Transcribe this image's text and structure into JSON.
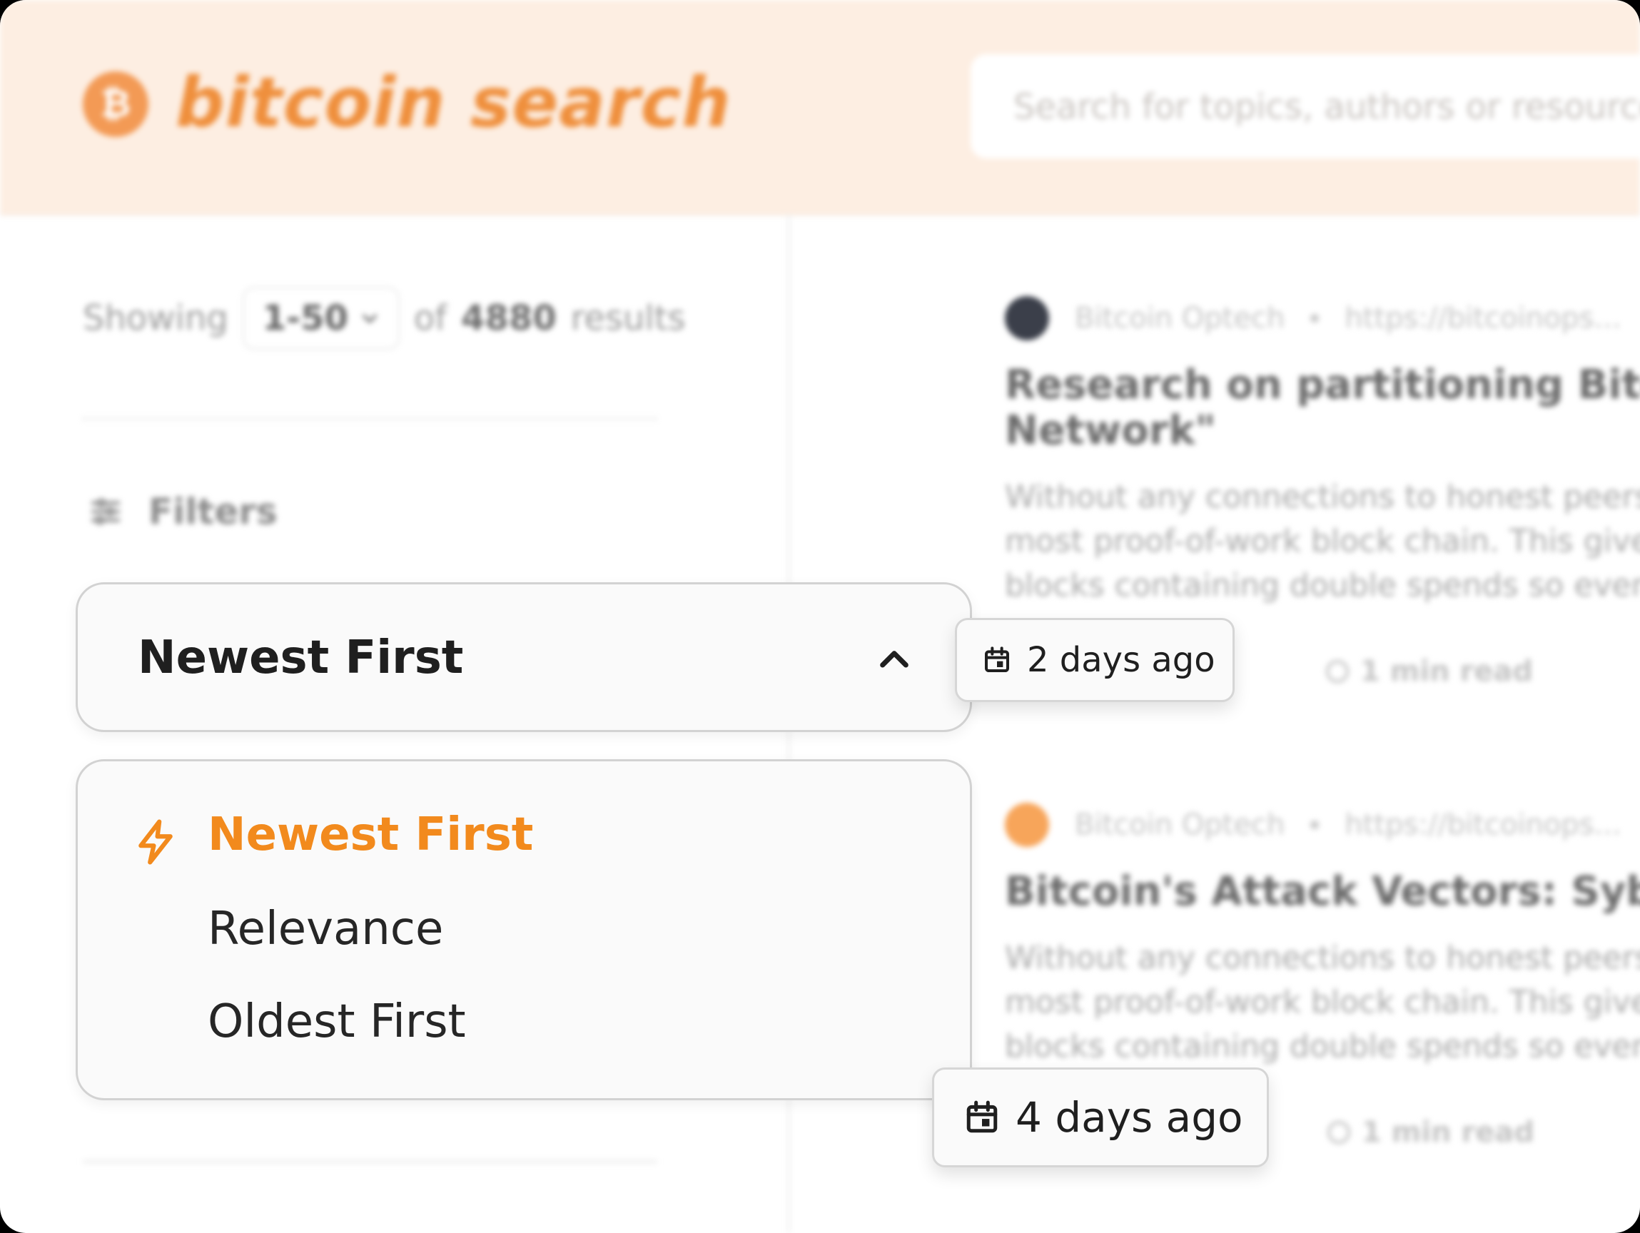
{
  "colors": {
    "accent": "#f28a1d",
    "header_bg": "#fdeee2",
    "logo": "#ef8f3c"
  },
  "header": {
    "brand": "bitcoin search",
    "logo_glyph": "₿",
    "search_placeholder": "Search for topics, authors or resources..."
  },
  "sidebar": {
    "showing_label": "Showing",
    "range": "1-50",
    "of_label": "of",
    "total": "4880",
    "results_label": "results",
    "filters_label": "Filters"
  },
  "sort": {
    "selected": "Newest First",
    "options": [
      {
        "label": "Newest First",
        "active": true,
        "icon": "bolt-icon"
      },
      {
        "label": "Relevance",
        "active": false
      },
      {
        "label": "Oldest First",
        "active": false
      }
    ]
  },
  "results": [
    {
      "source": "Bitcoin Optech",
      "url": "https://bitcoinops...",
      "title_line1": "Research on partitioning Bitcoin",
      "title_line2": "Network\"",
      "snippet": [
        "Without any connections to honest peers",
        "most proof-of-work block chain. This gives",
        "blocks containing double spends so even"
      ],
      "date": "2 days ago",
      "read_time": "1 min read",
      "avatar_color": "#3b3f4a"
    },
    {
      "source": "Bitcoin Optech",
      "url": "https://bitcoinops...",
      "title_line1": "Bitcoin's Attack Vectors: Sybil &",
      "title_line2": "",
      "snippet": [
        "Without any connections to honest peers",
        "most proof-of-work block chain. This gives",
        "blocks containing double spends so even"
      ],
      "date": "4 days ago",
      "read_time": "1 min read",
      "avatar_color": "#f7a55a"
    }
  ]
}
